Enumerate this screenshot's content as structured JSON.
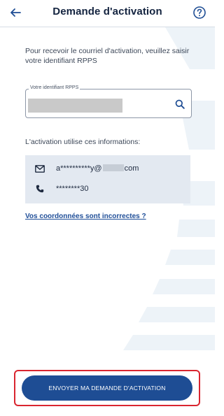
{
  "header": {
    "title": "Demande d'activation",
    "back_icon": "arrow-left-icon",
    "help_icon": "question-circle-icon"
  },
  "intro": {
    "text": "Pour recevoir le courriel d'activation, veuillez saisir votre identifiant RPPS"
  },
  "rpps_field": {
    "label": "Votre identifiant RPPS",
    "value": "",
    "search_icon": "search-icon"
  },
  "activation": {
    "label": "L'activation utilise ces informations:",
    "email_icon": "envelope-icon",
    "email_prefix": "a**********y@",
    "email_suffix": "com",
    "phone_icon": "phone-icon",
    "phone": "********30"
  },
  "link": {
    "text": "Vos coordonnées sont incorrectes ?"
  },
  "cta": {
    "label": "ENVOYER MA DEMANDE D'ACTIVATION"
  },
  "colors": {
    "primary": "#1e4d94",
    "link": "#1f4e98",
    "highlight_border": "#d9252f",
    "info_bg": "#e3e9f1",
    "title": "#13233f"
  }
}
